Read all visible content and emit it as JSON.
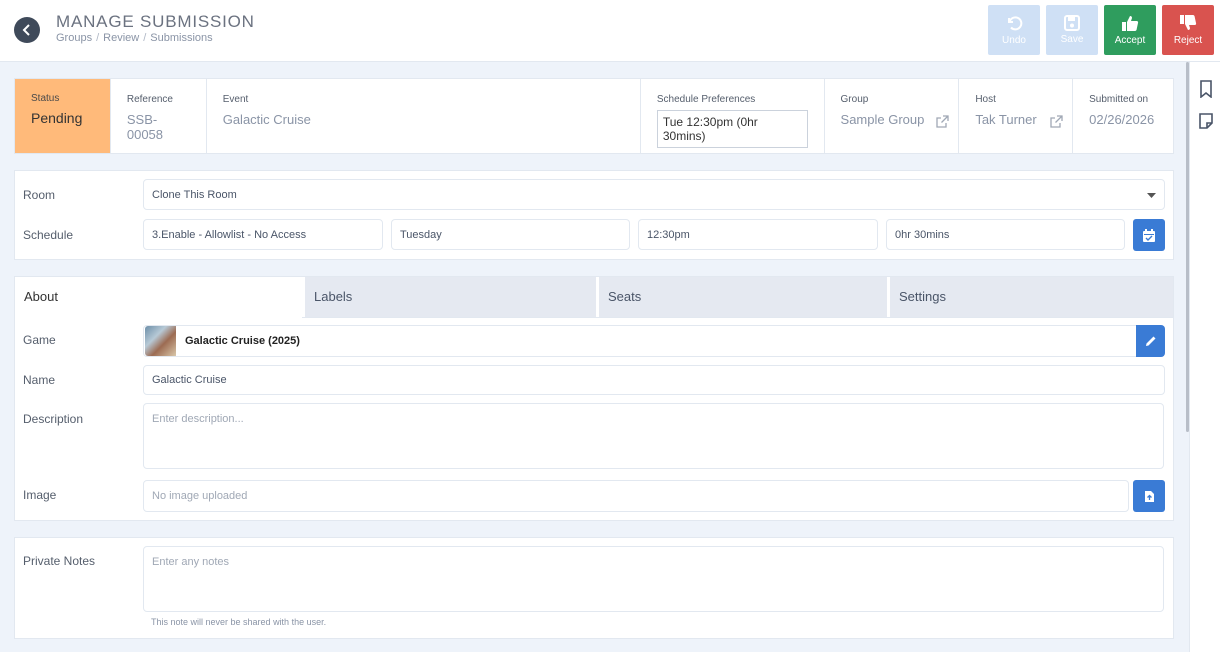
{
  "header": {
    "title": "MANAGE SUBMISSION",
    "breadcrumbs": [
      "Groups",
      "Review",
      "Submissions"
    ],
    "actions": {
      "undo": "Undo",
      "save": "Save",
      "accept": "Accept",
      "reject": "Reject"
    }
  },
  "summary": {
    "status_label": "Status",
    "status_value": "Pending",
    "reference_label": "Reference",
    "reference_value": "SSB-00058",
    "event_label": "Event",
    "event_value": "Galactic Cruise",
    "schedule_pref_label": "Schedule Preferences",
    "schedule_pref_value": "Tue 12:30pm (0hr 30mins)",
    "group_label": "Group",
    "group_value": "Sample Group",
    "host_label": "Host",
    "host_value": "Tak Turner",
    "submitted_label": "Submitted on",
    "submitted_value": "02/26/2026"
  },
  "room_section": {
    "room_label": "Room",
    "room_value": "Clone This Room",
    "schedule_label": "Schedule",
    "schedule_fields": [
      "3.Enable - Allowlist - No Access",
      "Tuesday",
      "12:30pm",
      "0hr 30mins"
    ]
  },
  "tabs": [
    "About",
    "Labels",
    "Seats",
    "Settings"
  ],
  "about": {
    "game_label": "Game",
    "game_value": "Galactic Cruise (2025)",
    "name_label": "Name",
    "name_value": "Galactic Cruise",
    "description_label": "Description",
    "description_placeholder": "Enter description...",
    "image_label": "Image",
    "image_value": "No image uploaded"
  },
  "notes": {
    "label": "Private Notes",
    "placeholder": "Enter any notes",
    "hint": "This note will never be shared with the user."
  },
  "colors": {
    "status_pending": "#ffba7a",
    "accept": "#2f9d5e",
    "reject": "#d9534f",
    "primary": "#3a7bd5",
    "disabled": "#cfe0f5"
  }
}
